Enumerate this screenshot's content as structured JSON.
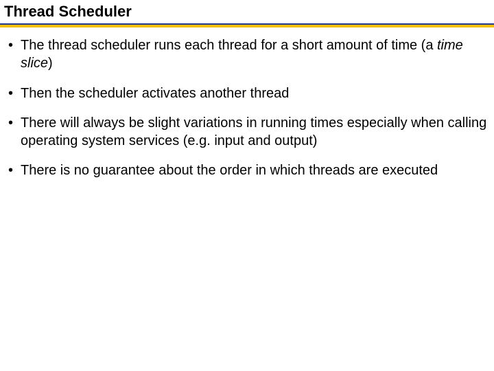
{
  "title": "Thread Scheduler",
  "bullets": {
    "b1_pre": "The thread scheduler runs each thread for a short amount of time (a ",
    "b1_em": "time slice",
    "b1_post": ")",
    "b2": "Then the scheduler activates another thread",
    "b3": "There will always be slight variations in running times especially when calling operating system services (e.g. input and output)",
    "b4": "There is no guarantee about the order in which threads are executed"
  }
}
